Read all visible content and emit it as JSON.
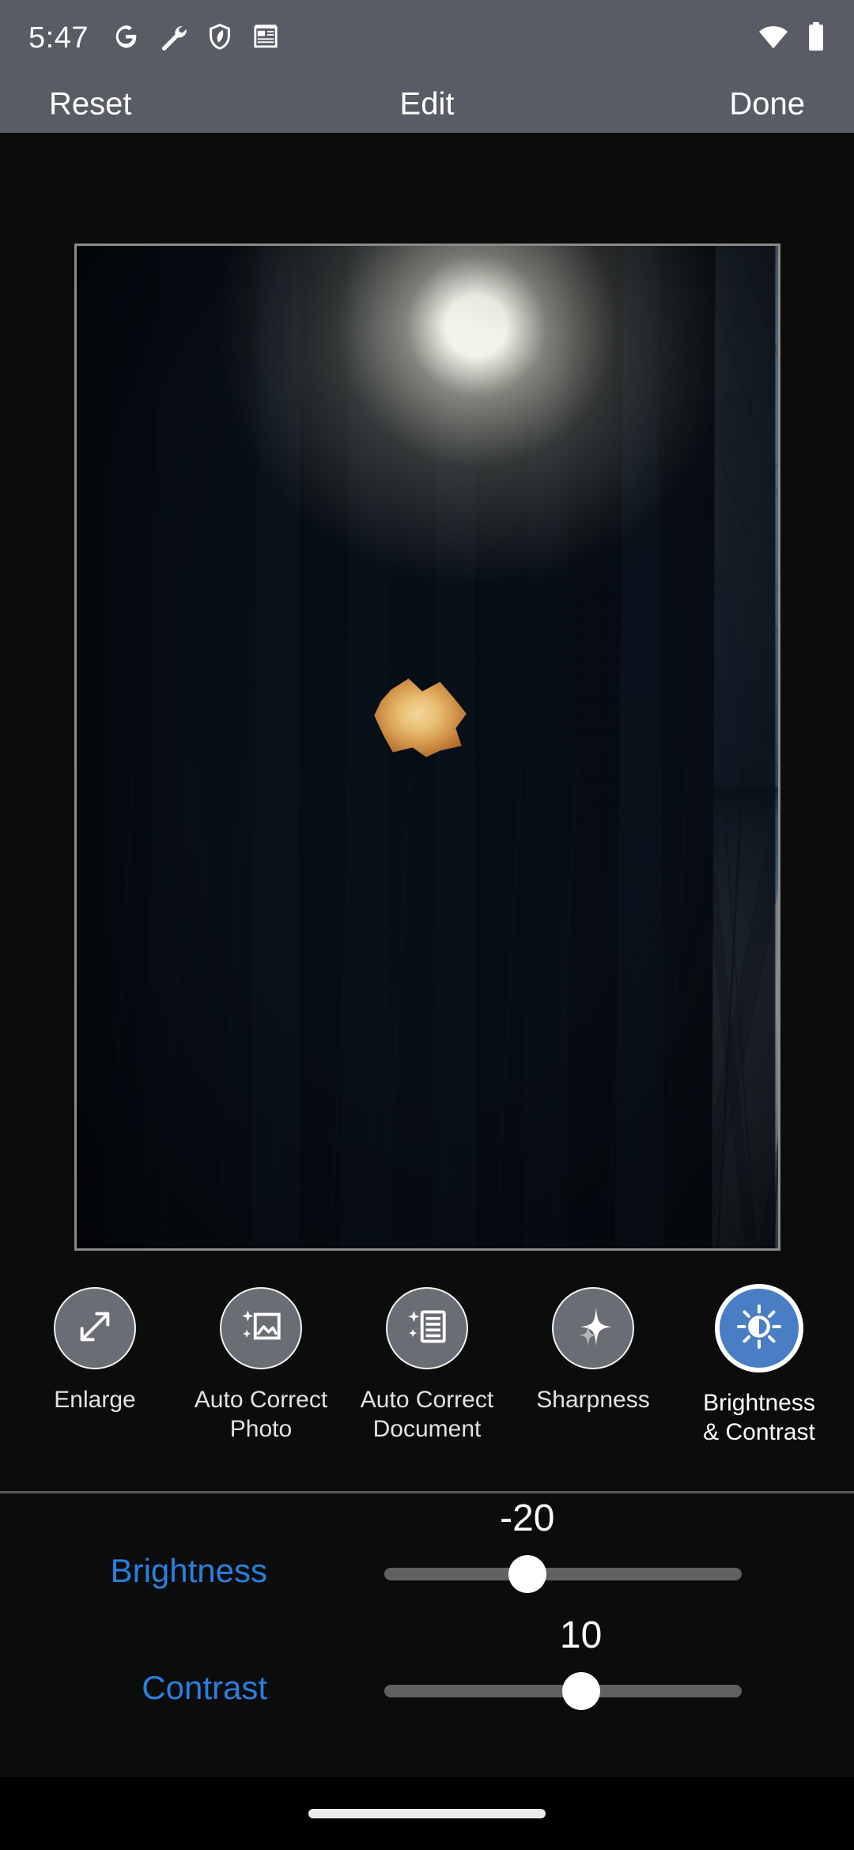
{
  "status_bar": {
    "time": "5:47",
    "left_icons": [
      {
        "name": "google-icon",
        "glyph": "G"
      },
      {
        "name": "wrench-icon",
        "glyph": "wrench"
      },
      {
        "name": "shield-icon",
        "glyph": "shield"
      },
      {
        "name": "news-icon",
        "glyph": "notepad"
      }
    ],
    "right_icons": [
      {
        "name": "wifi-icon",
        "glyph": "wifi-full"
      },
      {
        "name": "battery-icon",
        "glyph": "battery-full"
      }
    ],
    "background_color": "#595c64"
  },
  "action_bar": {
    "reset_label": "Reset",
    "title": "Edit",
    "done_label": "Done"
  },
  "photo": {
    "alt": "Sunlit winter forest with bare trees, snow covered ground and a single dry orange leaf hanging in the center"
  },
  "tools": [
    {
      "id": "enlarge",
      "label": "Enlarge",
      "icon": "enlarge-icon",
      "selected": false
    },
    {
      "id": "auto-correct-photo",
      "label": "Auto Correct\nPhoto",
      "icon": "auto-correct-photo-icon",
      "selected": false
    },
    {
      "id": "auto-correct-document",
      "label": "Auto Correct\nDocument",
      "icon": "auto-correct-document-icon",
      "selected": false
    },
    {
      "id": "sharpness",
      "label": "Sharpness",
      "icon": "sharpness-icon",
      "selected": false
    },
    {
      "id": "brightness-contrast",
      "label": "Brightness\n& Contrast",
      "icon": "brightness-contrast-icon",
      "selected": true
    }
  ],
  "sliders": [
    {
      "id": "brightness",
      "label": "Brightness",
      "value": "-20",
      "value_number": -20,
      "min": -100,
      "max": 100,
      "thumb_percent": 40,
      "fill_from_percent": 40,
      "fill_to_percent": 44
    },
    {
      "id": "contrast",
      "label": "Contrast",
      "value": "10",
      "value_number": 10,
      "min": -100,
      "max": 100,
      "thumb_percent": 55,
      "fill_from_percent": 55,
      "fill_to_percent": 55
    }
  ],
  "colors": {
    "accent_blue": "#2a7fe0",
    "selected_tool_blue": "#4a7ec4",
    "bar_gray": "#595c64",
    "track_gray": "#616161",
    "background": "#0b0c0c",
    "label_gray": "#e2e2e2"
  },
  "nav_bar": {
    "handle": "home-gesture-pill"
  }
}
